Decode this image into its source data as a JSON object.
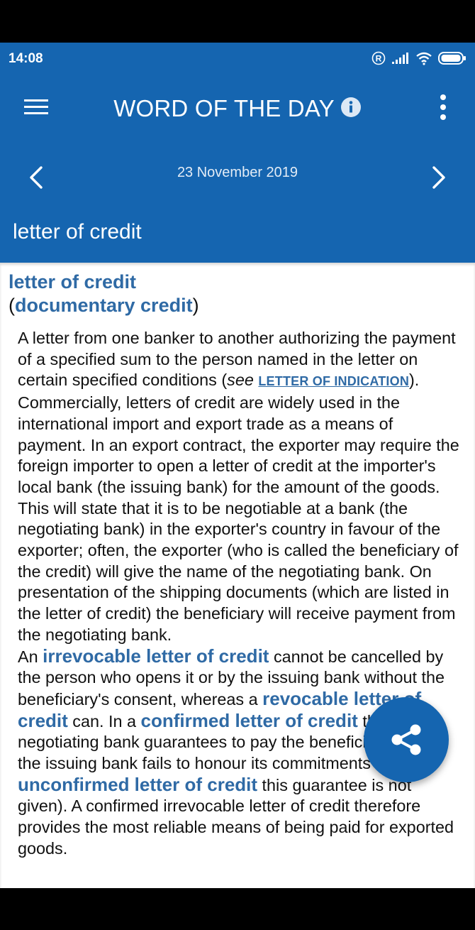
{
  "status_bar": {
    "time": "14:08",
    "registered_glyph": "R"
  },
  "header": {
    "title": "WORD OF THE DAY",
    "date": "23 November 2019",
    "term": "letter of credit"
  },
  "icons": {
    "menu": "hamburger-menu-icon",
    "info": "info-icon",
    "more": "more-vert-icon",
    "prev": "chevron-left-icon",
    "next": "chevron-right-icon",
    "share": "share-icon"
  },
  "colors": {
    "primary": "#1565b0",
    "link": "#2f6aa5",
    "text": "#111111"
  },
  "entry": {
    "headword": "letter of credit",
    "variant_open": "(",
    "variant": "documentary credit",
    "variant_close": ")",
    "para1": {
      "t1": "A letter from one banker to another authorizing the payment of a specified sum to the person named in the letter on certain specified conditions (",
      "see": "see",
      "xref": "LETTER OF INDICATION",
      "t2": "). Commercially, letters of credit are widely used in the international import and export trade as a means of payment. In an export contract, the exporter may require the foreign importer to open a letter of credit at the importer's local bank (the issuing bank) for the amount of the goods. This will state that it is to be negotiable at a bank (the negotiating bank) in the exporter's country in favour of the exporter; often, the exporter (who is called the beneficiary of the credit) will give the name of the negotiating bank. On presentation of the shipping documents (which are listed in the letter of credit) the beneficiary will receive payment from the negotiating bank."
    },
    "para2": {
      "t1": "An ",
      "kw1": "irrevocable letter of credit",
      "t2": " cannot be cancelled by the person who opens it or by the issuing bank without the beneficiary's consent, whereas a ",
      "kw2": "revocable letter of credit",
      "t3": " can. In a ",
      "kw3": "confirmed letter of credit",
      "t4": " the negotiating bank guarantees to pay the beneficiary, even if the issuing bank fails to honour its commitments (in an ",
      "kw4": "unconfirmed letter of credit",
      "t5": " this guarantee is not given). A confirmed irrevocable letter of credit therefore provides the most reliable means of being paid for exported goods."
    }
  }
}
